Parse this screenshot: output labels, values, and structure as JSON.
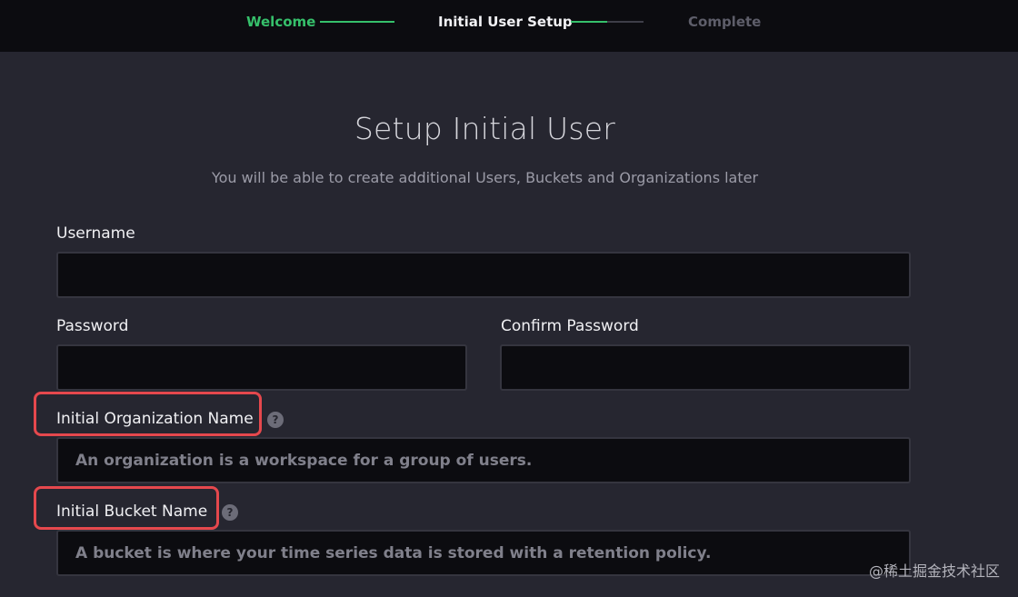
{
  "stepper": {
    "steps": [
      {
        "label": "Welcome",
        "state": "done"
      },
      {
        "label": "Initial User Setup",
        "state": "active"
      },
      {
        "label": "Complete",
        "state": "pending"
      }
    ],
    "progress": [
      1.0,
      0.5
    ]
  },
  "form": {
    "title": "Setup Initial User",
    "subtitle": "You will be able to create additional Users, Buckets and Organizations later",
    "username": {
      "label": "Username",
      "value": "",
      "placeholder": ""
    },
    "password": {
      "label": "Password",
      "value": "",
      "placeholder": ""
    },
    "confirm_password": {
      "label": "Confirm Password",
      "value": "",
      "placeholder": ""
    },
    "org": {
      "label": "Initial Organization Name",
      "value": "",
      "placeholder": "An organization is a workspace for a group of users."
    },
    "bucket": {
      "label": "Initial Bucket Name",
      "value": "",
      "placeholder": "A bucket is where your time series data is stored with a retention policy."
    }
  },
  "help_icon_glyph": "?",
  "watermark": "@稀土掘金技术社区",
  "colors": {
    "accent": "#36c06b",
    "background": "#262630",
    "highlight": "#e5484d"
  }
}
